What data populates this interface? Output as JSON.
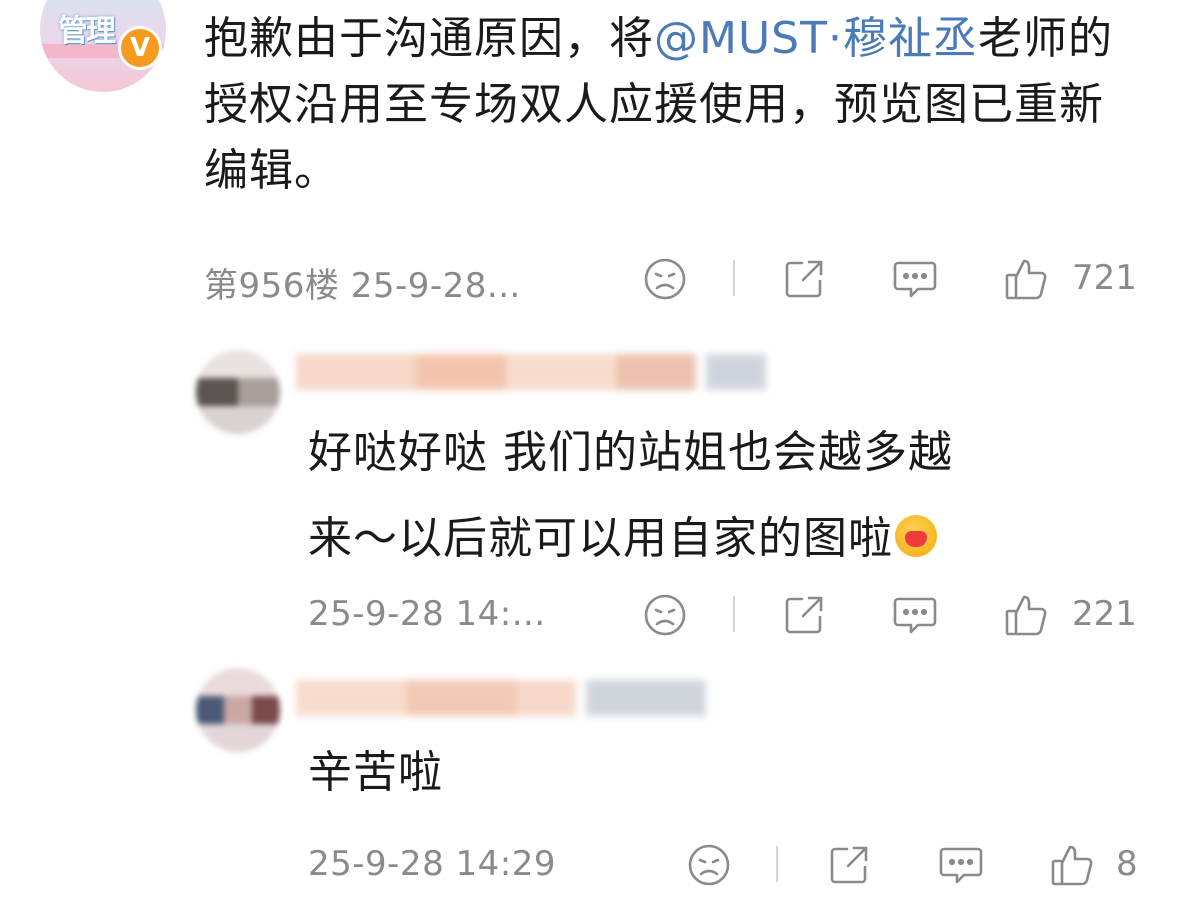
{
  "main_comment": {
    "text_prefix": "抱歉由于沟通原因，将",
    "mention": "@MUST·穆祉丞",
    "text_suffix": "老师的授权沿用至专场双人应援使用，预览图已重新编辑。",
    "verify_badge": "V",
    "floor_time": "第956楼 25-9-28...",
    "like_count": "721",
    "avatar_text": "管理"
  },
  "replies": [
    {
      "line1": "好哒好哒 我们的站姐也会越多越",
      "line2": "来～以后就可以用自家的图啦",
      "emoji": "hug-emoji",
      "time": "25-9-28 14:...",
      "like_count": "221"
    },
    {
      "line1": "辛苦啦",
      "time": "25-9-28 14:29",
      "like_count": "8"
    }
  ],
  "icons": {
    "dislike": "dislike-face-icon",
    "share": "share-icon",
    "comment": "comment-icon",
    "like": "thumbs-up-icon"
  },
  "colors": {
    "mention": "#4a7bb7",
    "meta": "#8a8a8a",
    "badge": "#f79a1e"
  }
}
